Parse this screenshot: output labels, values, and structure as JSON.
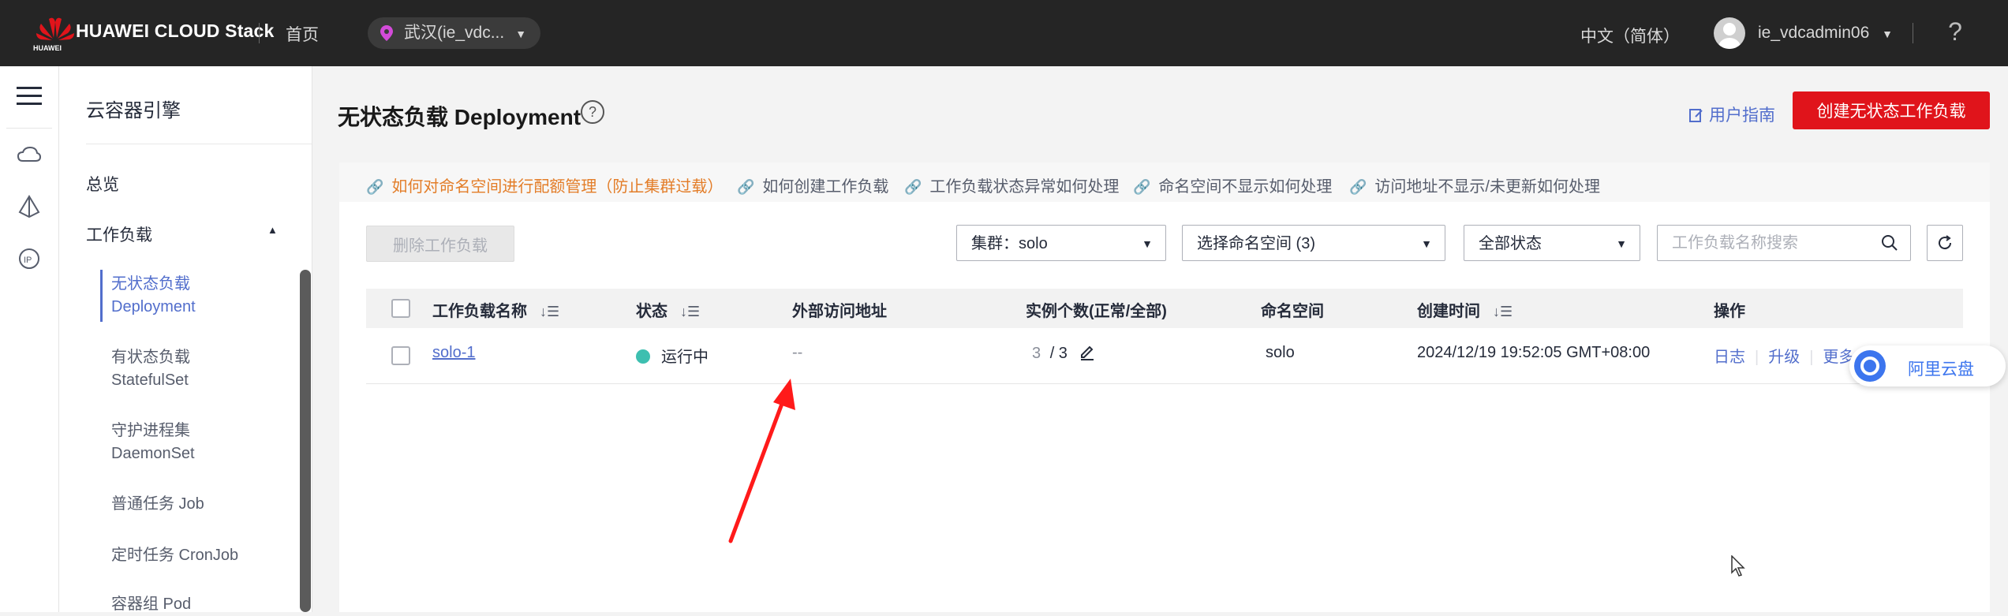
{
  "header": {
    "brand": "HUAWEI CLOUD Stack",
    "logo_text": "HUAWEI",
    "home": "首页",
    "region": "武汉(ie_vdc...",
    "language": "中文（简体）",
    "username": "ie_vdcadmin06",
    "help_icon": "?"
  },
  "rail": {
    "icons": [
      "menu-icon",
      "cloud-icon",
      "cluster-icon",
      "ip-icon"
    ]
  },
  "sidenav": {
    "title": "云容器引擎",
    "overview": "总览",
    "workloads": "工作负载",
    "items": [
      {
        "line1": "无状态负载",
        "line2": "Deployment"
      },
      {
        "line1": "有状态负载",
        "line2": "StatefulSet"
      },
      {
        "line1": "守护进程集",
        "line2": "DaemonSet"
      },
      {
        "line1": "普通任务 Job",
        "line2": ""
      },
      {
        "line1": "定时任务 CronJob",
        "line2": ""
      },
      {
        "line1": "容器组 Pod",
        "line2": ""
      }
    ]
  },
  "page": {
    "title": "无状态负载 Deployment",
    "user_guide": "用户指南",
    "create_button": "创建无状态工作负载"
  },
  "tips": [
    "如何对命名空间进行配额管理（防止集群过载）",
    "如何创建工作负载",
    "工作负载状态异常如何处理",
    "命名空间不显示如何处理",
    "访问地址不显示/未更新如何处理"
  ],
  "toolbar": {
    "delete_button": "删除工作负载",
    "cluster_select": "集群：solo",
    "namespace_select": "选择命名空间 (3)",
    "status_select": "全部状态",
    "search_placeholder": "工作负载名称搜索"
  },
  "table": {
    "columns": [
      "工作负载名称",
      "状态",
      "外部访问地址",
      "实例个数(正常/全部)",
      "命名空间",
      "创建时间",
      "操作"
    ],
    "rows": [
      {
        "name": "solo-1",
        "status": "运行中",
        "external_address": "--",
        "instances_normal": "3",
        "instances_total": "/ 3",
        "namespace": "solo",
        "created": "2024/12/19 19:52:05 GMT+08:00",
        "ops": [
          "日志",
          "升级",
          "更多"
        ]
      }
    ]
  },
  "overlay": {
    "aliyun_label": "阿里云盘"
  },
  "colors": {
    "topbar": "#252525",
    "primary_red": "#e0141b",
    "link_blue": "#526ecc",
    "tip_orange": "#e37d28",
    "status_green": "#3dbfb0",
    "annotation_arrow": "#ff1a1a"
  }
}
